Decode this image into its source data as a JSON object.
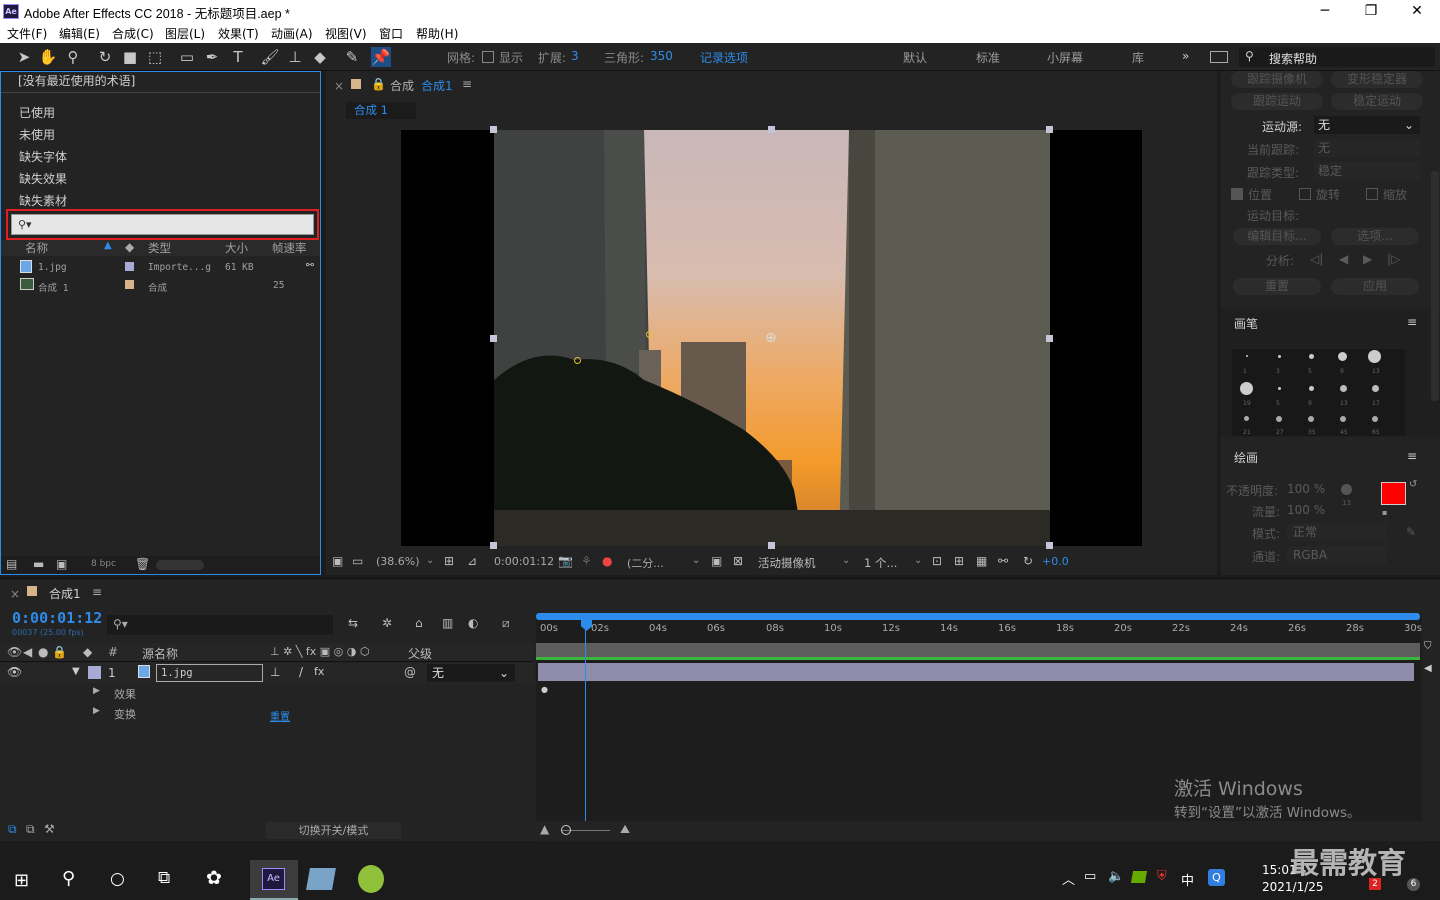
{
  "window": {
    "title": "Adobe After Effects CC 2018 - 无标题项目.aep *",
    "app_badge": "Ae"
  },
  "menu": [
    "文件(F)",
    "编辑(E)",
    "合成(C)",
    "图层(L)",
    "效果(T)",
    "动画(A)",
    "视图(V)",
    "窗口",
    "帮助(H)"
  ],
  "toolbar": {
    "grid_label": "网格:",
    "show_label": "显示",
    "expand_label": "扩展:",
    "expand_value": "3",
    "triangle_label": "三角形:",
    "triangle_value": "350",
    "record_label": "记录选项",
    "workspaces": [
      "默认",
      "标准",
      "小屏幕",
      "库"
    ],
    "more": "»",
    "search_help": "搜索帮助"
  },
  "project": {
    "recent_terms": "[没有最近使用的术语]",
    "filters": [
      "已使用",
      "未使用",
      "缺失字体",
      "缺失效果",
      "缺失素材"
    ],
    "search_placeholder": "",
    "columns": [
      "名称",
      "类型",
      "大小",
      "帧速率"
    ],
    "rows": [
      {
        "name": "1.jpg",
        "type": "Importe...g",
        "size": "61 KB",
        "fps": ""
      },
      {
        "name": "合成 1",
        "type": "合成",
        "size": "",
        "fps": "25"
      }
    ],
    "bpc": "8 bpc"
  },
  "viewer": {
    "tab_title": "合成",
    "tab_comp": "合成1",
    "comp_chip": "合成 1",
    "zoom": "(38.6%)",
    "timecode": "0:00:01:12",
    "resolution": "(二分...",
    "camera": "活动摄像机",
    "views": "1 个...",
    "exposure": "+0.0"
  },
  "tracker": {
    "track_camera": "跟踪摄像机",
    "warp_stabilizer": "变形稳定器",
    "track_motion": "跟踪运动",
    "stabilize_motion": "稳定运动",
    "motion_source_label": "运动源:",
    "motion_source_value": "无",
    "current_track_label": "当前跟踪:",
    "current_track_value": "无",
    "track_type_label": "跟踪类型:",
    "track_type_value": "稳定",
    "position": "位置",
    "rotation": "旋转",
    "scale": "缩放",
    "motion_target_label": "运动目标:",
    "edit_target": "编辑目标...",
    "options": "选项...",
    "analyze_label": "分析:",
    "reset": "重置",
    "apply": "应用"
  },
  "brushes": {
    "title": "画笔",
    "sizes": [
      "1",
      "3",
      "5",
      "9",
      "13",
      "19",
      "5",
      "9",
      "13",
      "17",
      "21",
      "27",
      "35",
      "45",
      "65"
    ]
  },
  "paint": {
    "title": "绘画",
    "opacity_label": "不透明度:",
    "opacity_value": "100 %",
    "flow_label": "流量:",
    "flow_value": "100 %",
    "mode_label": "模式:",
    "mode_value": "正常",
    "channel_label": "通道:",
    "channel_value": "RGBA",
    "brush_size": "13",
    "fg_color": "#ff0000",
    "bg_color": "#ffffff"
  },
  "timeline": {
    "tab": "合成1",
    "timecode": "0:00:01:12",
    "frames": "00037 (25.00 fps)",
    "headers": {
      "source": "源名称",
      "parent": "父级",
      "num": "#"
    },
    "layer": {
      "index": "1",
      "name": "1.jpg",
      "parent": "无"
    },
    "sub": [
      {
        "label": "效果"
      },
      {
        "label": "变换",
        "action": "重置"
      }
    ],
    "ticks": [
      "00s",
      "02s",
      "04s",
      "06s",
      "08s",
      "10s",
      "12s",
      "14s",
      "16s",
      "18s",
      "20s",
      "22s",
      "24s",
      "26s",
      "28s",
      "30s"
    ],
    "toggle_label": "切换开关/模式"
  },
  "watermark": {
    "line1": "激活 Windows",
    "line2": "转到“设置”以激活 Windows。",
    "logo": "最需教育"
  },
  "taskbar": {
    "time": "15:01",
    "date": "2021/1/25",
    "ime": "中",
    "badge1": "2",
    "badge2": "6"
  }
}
